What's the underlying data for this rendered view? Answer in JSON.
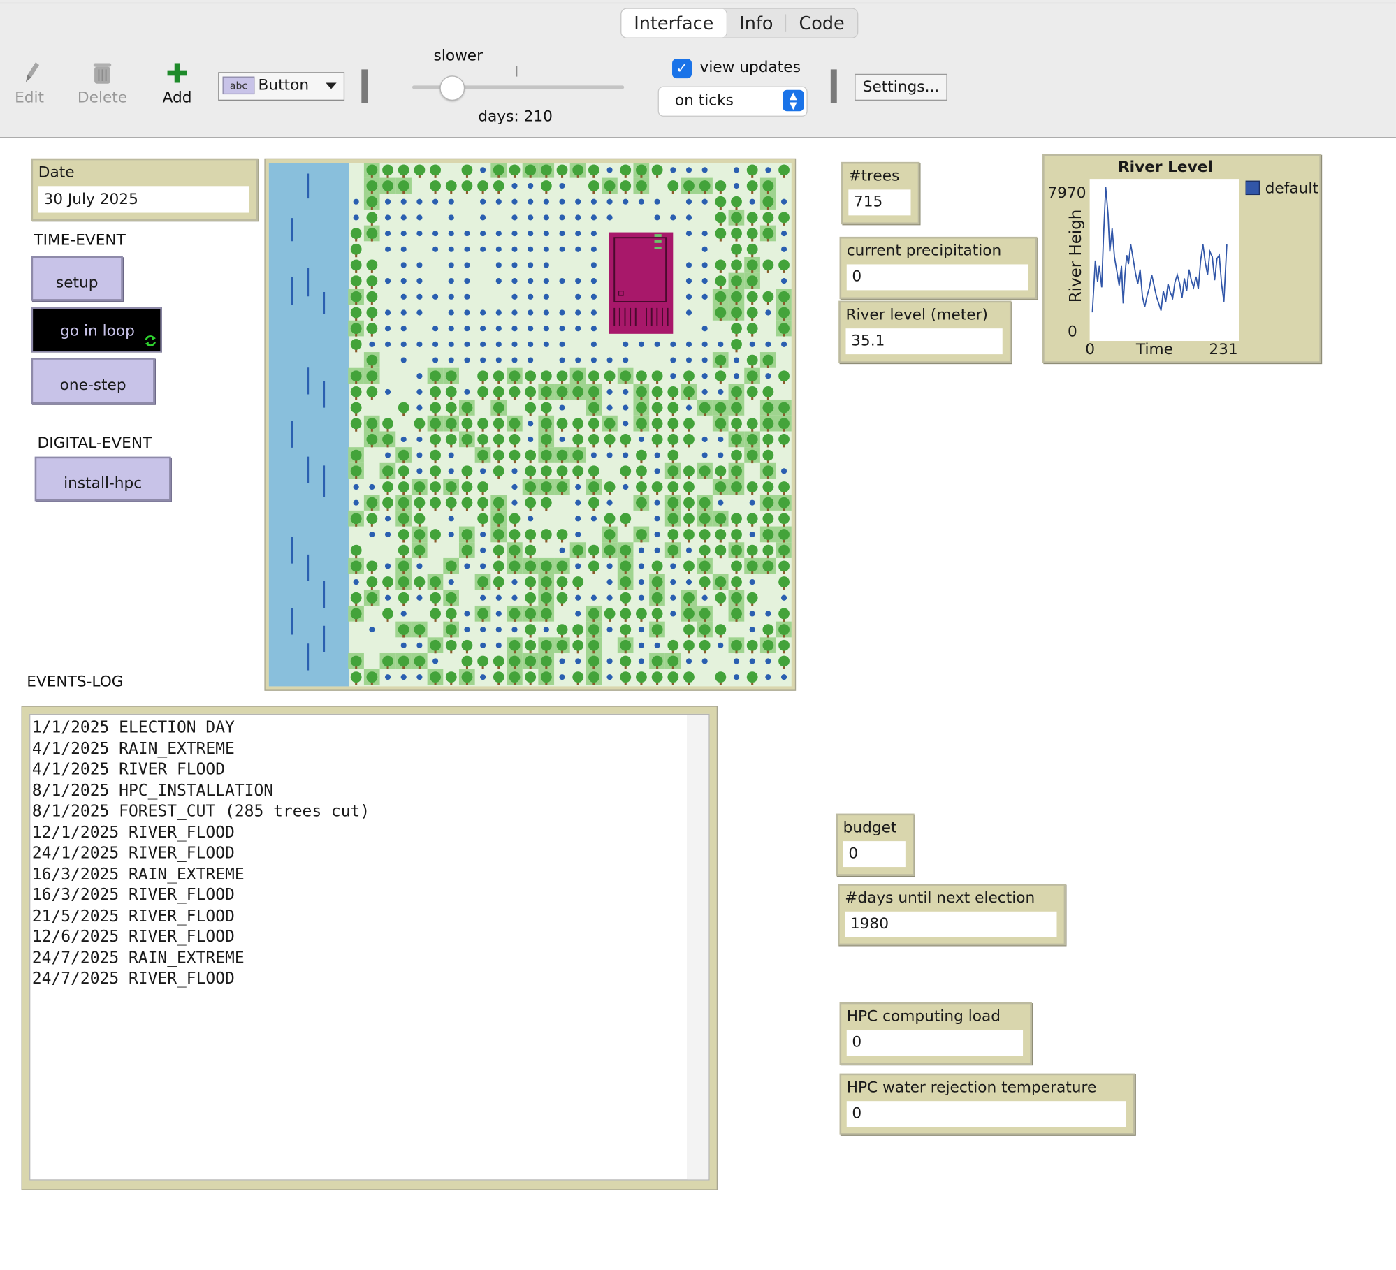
{
  "toolbar": {
    "tabs": [
      {
        "label": "Interface",
        "active": true
      },
      {
        "label": "Info",
        "active": false
      },
      {
        "label": "Code",
        "active": false
      }
    ],
    "edit_label": "Edit",
    "delete_label": "Delete",
    "add_label": "Add",
    "widget_type": "Button",
    "speed_label": "slower",
    "speed_value": 0.2,
    "tick_counter": "days: 210",
    "view_updates_label": "view updates",
    "view_updates_checked": true,
    "update_mode": "on ticks",
    "settings_label": "Settings..."
  },
  "left_panel": {
    "date_monitor": {
      "label": "Date",
      "value": "30 July 2025"
    },
    "time_event_label": "TIME-EVENT",
    "setup_button": "setup",
    "go_button": "go in loop",
    "one_step_button": "one-step",
    "digital_event_label": "DIGITAL-EVENT",
    "install_hpc_button": "install-hpc"
  },
  "monitors": {
    "trees": {
      "label": "#trees",
      "value": "715"
    },
    "precipitation": {
      "label": "current precipitation",
      "value": "0"
    },
    "river_level": {
      "label": "River level (meter)",
      "value": "35.1"
    },
    "budget": {
      "label": "budget",
      "value": "0"
    },
    "days_until_election": {
      "label": "#days until next election",
      "value": "1980"
    },
    "hpc_load": {
      "label": "HPC computing load",
      "value": "0"
    },
    "hpc_water_temp": {
      "label": "HPC water rejection temperature",
      "value": "0"
    }
  },
  "chart_data": {
    "type": "line",
    "title": "River Level",
    "xlabel": "Time",
    "ylabel": "River Heigh",
    "xlim": [
      0,
      231
    ],
    "ylim": [
      0,
      7970
    ],
    "x_ticks": [
      "0",
      "231"
    ],
    "y_ticks": [
      "0",
      "7970"
    ],
    "legend_position": "top-right",
    "series": [
      {
        "name": "default",
        "color": "#3156a8",
        "x": [
          0,
          5,
          9,
          12,
          16,
          19,
          23,
          27,
          30,
          34,
          38,
          42,
          46,
          50,
          53,
          56,
          59,
          62,
          66,
          70,
          74,
          78,
          82,
          86,
          90,
          94,
          98,
          102,
          106,
          110,
          114,
          118,
          122,
          126,
          130,
          134,
          138,
          142,
          146,
          150,
          154,
          158,
          162,
          166,
          170,
          174,
          178,
          182,
          186,
          190,
          194,
          198,
          202,
          206,
          210,
          214,
          218,
          222,
          226,
          231
        ],
        "values": [
          700,
          3600,
          2400,
          3300,
          2100,
          4800,
          7700,
          6200,
          4100,
          5400,
          3800,
          3000,
          2200,
          3300,
          1200,
          2800,
          3900,
          3400,
          4500,
          3700,
          2900,
          2300,
          3100,
          1600,
          1000,
          1600,
          2100,
          2800,
          2200,
          1600,
          1200,
          800,
          1900,
          1300,
          2300,
          1800,
          1500,
          2400,
          2800,
          2300,
          1500,
          2600,
          1900,
          3100,
          2500,
          2100,
          2700,
          2000,
          3600,
          4500,
          3500,
          2800,
          4100,
          3800,
          2500,
          3700,
          3900,
          2300,
          1300,
          4500
        ]
      }
    ]
  },
  "events_log": {
    "label": "EVENTS-LOG",
    "lines": [
      "1/1/2025 ELECTION_DAY",
      "4/1/2025 RAIN_EXTREME",
      "4/1/2025 RIVER_FLOOD",
      "8/1/2025 HPC_INSTALLATION",
      "8/1/2025 FOREST_CUT (285 trees cut)",
      "12/1/2025 RIVER_FLOOD",
      "24/1/2025 RIVER_FLOOD",
      "16/3/2025 RAIN_EXTREME",
      "16/3/2025 RIVER_FLOOD",
      "21/5/2025 RIVER_FLOOD",
      "12/6/2025 RIVER_FLOOD",
      "24/7/2025 RAIN_EXTREME",
      "24/7/2025 RIVER_FLOOD"
    ]
  },
  "world": {
    "river_color": "#89bfdc",
    "land_color": "#e4f2dc",
    "tree_color": "#43a33a",
    "patch_color": "#9fd48f",
    "dot_color": "#2a5fb0",
    "building_color": "#a8186a"
  }
}
